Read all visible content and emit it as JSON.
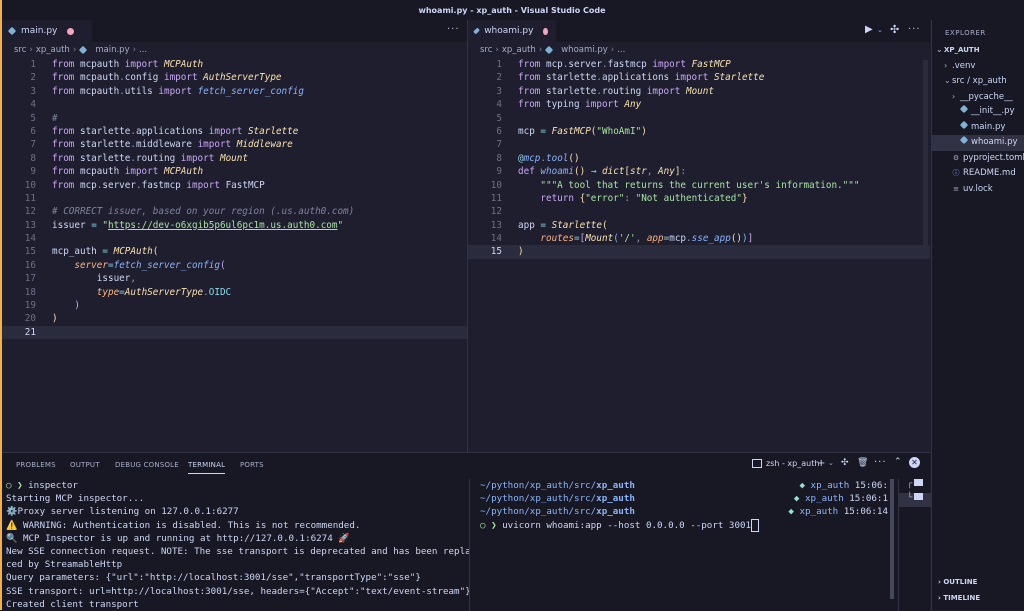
{
  "window": {
    "title": "whoami.py - xp_auth - Visual Studio Code"
  },
  "left_editor": {
    "tab": {
      "label": "main.py"
    },
    "breadcrumb": [
      "src",
      "xp_auth",
      "main.py",
      "..."
    ],
    "lines": [
      {
        "n": "1",
        "html": "<span class='kw'>from</span> mcpauth <span class='kw'>import</span> <span class='cls'>MCPAuth</span>"
      },
      {
        "n": "2",
        "html": "<span class='kw'>from</span> mcpauth<span class='pun'>.</span>config <span class='kw'>import</span> <span class='cls'>AuthServerType</span>"
      },
      {
        "n": "3",
        "html": "<span class='kw'>from</span> mcpauth<span class='pun'>.</span>utils <span class='kw'>import</span> <span class='fn'>fetch_server_config</span>"
      },
      {
        "n": "4",
        "html": ""
      },
      {
        "n": "5",
        "html": "<span class='cm'>#</span>"
      },
      {
        "n": "6",
        "html": "<span class='kw'>from</span> starlette<span class='pun'>.</span>applications <span class='kw'>import</span> <span class='cls'>Starlette</span>"
      },
      {
        "n": "7",
        "html": "<span class='kw'>from</span> starlette<span class='pun'>.</span>middleware <span class='kw'>import</span> <span class='cls'>Middleware</span>"
      },
      {
        "n": "8",
        "html": "<span class='kw'>from</span> starlette<span class='pun'>.</span>routing <span class='kw'>import</span> <span class='cls'>Mount</span>"
      },
      {
        "n": "9",
        "html": "<span class='kw'>from</span> mcpauth <span class='kw'>import</span> <span class='cls'>MCPAuth</span>"
      },
      {
        "n": "10",
        "html": "<span class='kw'>from</span> mcp<span class='pun'>.</span>server<span class='pun'>.</span>fastmcp <span class='kw'>import</span> FastMCP"
      },
      {
        "n": "11",
        "html": ""
      },
      {
        "n": "12",
        "html": "<span class='cm'># CORRECT issuer, based on your region (.us.auth0.com)</span>"
      },
      {
        "n": "13",
        "html": "issuer <span class='op'>=</span> <span class='str'>\"</span><span class='url'>https://dev-o6xgib5p6ul6pc1m.us.auth0.com</span><span class='str'>\"</span>"
      },
      {
        "n": "14",
        "html": ""
      },
      {
        "n": "15",
        "html": "mcp_auth <span class='op'>=</span> <span class='cls'>MCPAuth</span><span class='brk'>(</span>"
      },
      {
        "n": "16",
        "html": "    <span class='par'>server</span><span class='op'>=</span><span class='fn'>fetch_server_config</span><span class='brk2'>(</span>"
      },
      {
        "n": "17",
        "html": "        issuer<span class='pun'>,</span>"
      },
      {
        "n": "18",
        "html": "        <span class='par'>type</span><span class='op'>=</span><span class='cls'>AuthServerType</span><span class='pun'>.</span><span class='op'>OIDC</span>"
      },
      {
        "n": "19",
        "html": "    <span class='brk2'>)</span>"
      },
      {
        "n": "20",
        "html": "<span class='brk'>)</span>"
      },
      {
        "n": "21",
        "html": ""
      }
    ]
  },
  "right_editor": {
    "tab": {
      "label": "whoami.py"
    },
    "breadcrumb": [
      "src",
      "xp_auth",
      "whoami.py",
      "..."
    ],
    "lines": [
      {
        "n": "1",
        "html": "<span class='kw'>from</span> mcp<span class='pun'>.</span>server<span class='pun'>.</span>fastmcp <span class='kw'>import</span> <span class='cls'>FastMCP</span>"
      },
      {
        "n": "2",
        "html": "<span class='kw'>from</span> starlette<span class='pun'>.</span>applications <span class='kw'>import</span> <span class='cls'>Starlette</span>"
      },
      {
        "n": "3",
        "html": "<span class='kw'>from</span> starlette<span class='pun'>.</span>routing <span class='kw'>import</span> <span class='cls'>Mount</span>"
      },
      {
        "n": "4",
        "html": "<span class='kw'>from</span> typing <span class='kw'>import</span> <span class='cls'>Any</span>"
      },
      {
        "n": "5",
        "html": ""
      },
      {
        "n": "6",
        "html": "mcp <span class='op'>=</span> <span class='cls'>FastMCP</span><span class='brk'>(</span><span class='str'>\"WhoAmI\"</span><span class='brk'>)</span>"
      },
      {
        "n": "7",
        "html": ""
      },
      {
        "n": "8",
        "html": "<span class='op'>@</span><span class='fn'>mcp</span><span class='pun'>.</span><span class='fn'>tool</span><span class='brk'>()</span>"
      },
      {
        "n": "9",
        "html": "<span class='kw'>def</span> <span class='fn'>whoami</span><span class='brk'>()</span> <span class='op'>→</span> <span class='cls'>dict</span><span class='brk'>[</span><span class='cls'>str</span><span class='pun'>,</span> <span class='cls'>Any</span><span class='brk'>]</span><span class='pun'>:</span>"
      },
      {
        "n": "10",
        "html": "    <span class='str'>\"\"\"A tool that returns the current user's information.\"\"\"</span>"
      },
      {
        "n": "11",
        "html": "    <span class='kw'>return</span> <span class='brk'>{</span><span class='str'>\"error\"</span><span class='pun'>:</span> <span class='str'>\"Not authenticated\"</span><span class='brk'>}</span>"
      },
      {
        "n": "12",
        "html": ""
      },
      {
        "n": "13",
        "html": "app <span class='op'>=</span> <span class='cls'>Starlette</span><span class='brk'>(</span>"
      },
      {
        "n": "14",
        "html": "    <span class='par'>routes</span><span class='op'>=</span><span class='brk2'>[</span><span class='cls'>Mount</span><span class='fnc'>(</span><span class='str'>'/'</span><span class='pun'>,</span> <span class='par'>app</span><span class='op'>=</span>mcp<span class='pun'>.</span><span class='fn'>sse_app</span><span class='brk'>()</span><span class='fnc'>)</span><span class='brk2'>]</span>"
      },
      {
        "n": "15",
        "html": "<span class='brk'>)</span>"
      }
    ]
  },
  "explorer": {
    "title": "EXPLORER",
    "root": "XP_AUTH",
    "items": [
      {
        "label": ".venv",
        "indent": 1,
        "twisty": "›",
        "icon": "",
        "sel": false
      },
      {
        "label": "src / xp_auth",
        "indent": 1,
        "twisty": "⌄",
        "icon": "",
        "sel": false
      },
      {
        "label": "__pycache__",
        "indent": 2,
        "twisty": "›",
        "icon": "",
        "sel": false
      },
      {
        "label": "__init__.py",
        "indent": 2,
        "twisty": "",
        "icon": "py",
        "sel": false
      },
      {
        "label": "main.py",
        "indent": 2,
        "twisty": "",
        "icon": "py",
        "sel": false
      },
      {
        "label": "whoami.py",
        "indent": 2,
        "twisty": "",
        "icon": "py",
        "sel": true
      },
      {
        "label": "pyproject.toml",
        "indent": 1,
        "twisty": "",
        "icon": "gear",
        "sel": false
      },
      {
        "label": "README.md",
        "indent": 1,
        "twisty": "",
        "icon": "info",
        "sel": false
      },
      {
        "label": "uv.lock",
        "indent": 1,
        "twisty": "",
        "icon": "lines",
        "sel": false
      }
    ],
    "outline": "OUTLINE",
    "timeline": "TIMELINE"
  },
  "panel": {
    "tabs": [
      "PROBLEMS",
      "OUTPUT",
      "DEBUG CONSOLE",
      "TERMINAL",
      "PORTS"
    ],
    "active_tab": "TERMINAL",
    "terminal_name": "zsh - xp_auth",
    "left_terminal": [
      {
        "html": "<span class='green'>○ ❯</span> inspector"
      },
      {
        "html": "Starting MCP inspector..."
      },
      {
        "html": "⚙️Proxy server listening on 127.0.0.1:6277"
      },
      {
        "html": "⚠️ WARNING: Authentication is disabled. This is not recommended."
      },
      {
        "html": "🔍 MCP Inspector is up and running at http://127.0.0.1:6274 🚀"
      },
      {
        "html": "New SSE connection request. NOTE: The sse transport is deprecated and has been repla"
      },
      {
        "html": "ced by StreamableHttp"
      },
      {
        "html": "Query parameters: {\"url\":\"http://localhost:3001/sse\",\"transportType\":\"sse\"}"
      },
      {
        "html": "SSE transport: url=http://localhost:3001/sse, headers={\"Accept\":\"text/event-stream\"}"
      },
      {
        "html": "Created client transport"
      }
    ],
    "right_terminal": [
      {
        "html": "<span class='blue'>~/python/xp_auth/src/</span><span class='blue bold'>xp_auth</span>",
        "time": "<span class='teal'>◆</span> <span class='blue'>xp_auth</span> 15:06:"
      },
      {
        "html": "<span class='blue'>~/python/xp_auth/src/</span><span class='blue bold'>xp_auth</span>",
        "time": "<span class='teal'>◆</span> <span class='blue'>xp_auth</span> 15:06:1"
      },
      {
        "html": "<span class='blue'>~/python/xp_auth/src/</span><span class='blue bold'>xp_auth</span>",
        "time": "<span class='teal'>◆</span> <span class='blue'>xp_auth</span> 15:06:14"
      },
      {
        "html": "<span class='green'>○ ❯</span> uvicorn whoami:app --host 0.0.0.0 --port 3001<span class='cursor'></span>",
        "time": ""
      }
    ]
  }
}
